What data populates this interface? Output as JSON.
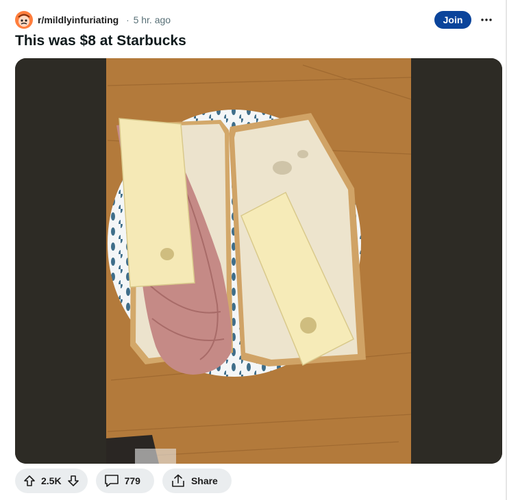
{
  "post": {
    "subreddit": "r/mildlyinfuriating",
    "separator": "·",
    "time_ago": "5 hr. ago",
    "title": "This was $8 at Starbucks"
  },
  "header": {
    "join_label": "Join",
    "more_icon": "ellipsis-icon"
  },
  "media": {
    "icon": "sandwich-photo"
  },
  "actions": {
    "upvote_icon": "arrow-up-icon",
    "vote_count": "2.5K",
    "downvote_icon": "arrow-down-icon",
    "comment_icon": "speech-bubble-icon",
    "comment_count": "779",
    "share_icon": "share-icon",
    "share_label": "Share"
  },
  "colors": {
    "join_bg": "#0a449b",
    "pill_bg": "#eaedef",
    "avatar_bg": "#ff7e3d"
  }
}
